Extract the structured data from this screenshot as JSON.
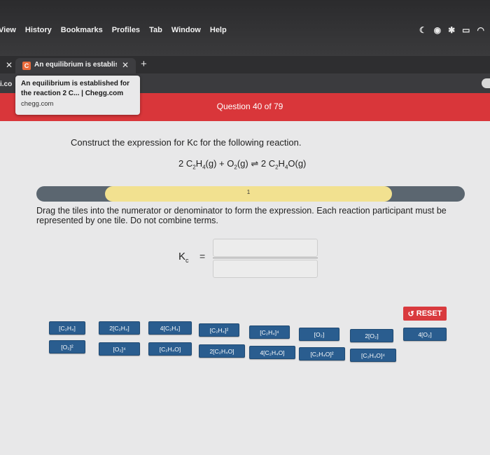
{
  "menubar": {
    "items": [
      "View",
      "History",
      "Bookmarks",
      "Profiles",
      "Tab",
      "Window",
      "Help"
    ],
    "status_icons": [
      "moon-icon",
      "record-icon",
      "bluetooth-icon",
      "battery-icon",
      "wifi-icon"
    ]
  },
  "tabs": {
    "active_title": "An equilibrium is established fo",
    "favicon_letter": "C"
  },
  "toolbar": {
    "left_stub": "i.co"
  },
  "tooltip": {
    "title": "An equilibrium is established for the reaction 2 C... | Chegg.com",
    "url": "chegg.com"
  },
  "header": {
    "question_counter": "Question 40 of 79",
    "accent_color": "#d9363a"
  },
  "question": {
    "instruction": "Construct the expression for Kc for the following reaction.",
    "eq_coef1": "2 C",
    "eq_sub1": "2",
    "eq_h1": "H",
    "eq_sub2": "4",
    "eq_rest1": "(g) + O",
    "eq_sub3": "2",
    "eq_rest2": "(g)",
    "eq_arrow": "⇌",
    "eq_coef2": "2 C",
    "eq_sub4": "2",
    "eq_h2": "H",
    "eq_sub5": "4",
    "eq_rest3": "O(g)"
  },
  "progress": {
    "step": "1"
  },
  "drag_instructions": "Drag the tiles into the numerator or denominator to form the expression. Each reaction participant must be represented by one tile. Do not combine terms.",
  "kc": {
    "symbol": "K",
    "subscript": "c",
    "equals": "="
  },
  "reset": {
    "label": "RESET",
    "icon": "undo-icon"
  },
  "tiles_row1": [
    "[C₂H₄]",
    "2[C₂H₄]",
    "4[C₂H₄]",
    "[C₂H₄]²",
    "[C₂H₄]⁴",
    "[O₂]",
    "2[O₂]",
    "4[O₂]"
  ],
  "tiles_row2": [
    "[O₂]²",
    "[O₂]⁴",
    "[C₂H₄O]",
    "2[C₂H₄O]",
    "4[C₂H₄O]",
    "[C₂H₄O]²",
    "[C₂H₄O]⁴"
  ]
}
